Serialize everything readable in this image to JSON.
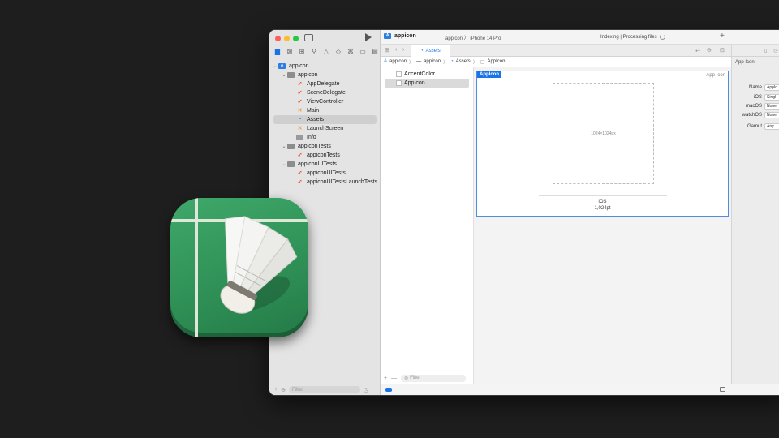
{
  "window": {
    "project_title": "appicon",
    "scheme": "appicon 〉 iPhone 14 Pro",
    "status": "Indexing | Processing files"
  },
  "navigator": {
    "items": [
      {
        "label": "appicon",
        "icon": "project-icon",
        "level": 0,
        "chevron": "⌄"
      },
      {
        "label": "appicon",
        "icon": "folder-icon",
        "level": 1,
        "chevron": "⌄"
      },
      {
        "label": "AppDelegate",
        "icon": "swift-file-icon",
        "level": 2
      },
      {
        "label": "SceneDelegate",
        "icon": "swift-file-icon",
        "level": 2
      },
      {
        "label": "ViewController",
        "icon": "swift-file-icon",
        "level": 2
      },
      {
        "label": "Main",
        "icon": "storyboard-icon",
        "level": 2
      },
      {
        "label": "Assets",
        "icon": "asset-catalog-icon",
        "level": 2,
        "selected": true
      },
      {
        "label": "LaunchScreen",
        "icon": "storyboard-icon",
        "level": 2
      },
      {
        "label": "Info",
        "icon": "plist-icon",
        "level": 2
      },
      {
        "label": "appiconTests",
        "icon": "folder-icon",
        "level": 1,
        "chevron": "⌄"
      },
      {
        "label": "appiconTests",
        "icon": "swift-file-icon",
        "level": 2
      },
      {
        "label": "appiconUITests",
        "icon": "folder-icon",
        "level": 1,
        "chevron": "⌄"
      },
      {
        "label": "appiconUITests",
        "icon": "swift-file-icon",
        "level": 2
      },
      {
        "label": "appiconUITestsLaunchTests",
        "icon": "swift-file-icon",
        "level": 2
      }
    ],
    "filter_placeholder": "Filter"
  },
  "tab": {
    "label": "Assets"
  },
  "jumpbar": [
    "appicon",
    "appicon",
    "Assets",
    "AppIcon"
  ],
  "asset_list": {
    "items": [
      {
        "label": "AccentColor"
      },
      {
        "label": "AppIcon",
        "selected": true
      }
    ],
    "filter_placeholder": "Filter"
  },
  "editor": {
    "badge": "AppIcon",
    "corner_label": "App Icon",
    "slot_label": "1024×1024px",
    "caption_line1": "iOS",
    "caption_line2": "1,024pt"
  },
  "inspector": {
    "title": "App Icon",
    "rows": [
      {
        "label": "Name",
        "value": "AppIc"
      },
      {
        "label": "iOS",
        "value": "Singl"
      },
      {
        "label": "macOS",
        "value": "None"
      },
      {
        "label": "watchOS",
        "value": "None"
      },
      {
        "label": "Gamut",
        "value": "Any"
      }
    ]
  },
  "colors": {
    "accent": "#1a74e8",
    "icon_green": "#2e8f55"
  }
}
